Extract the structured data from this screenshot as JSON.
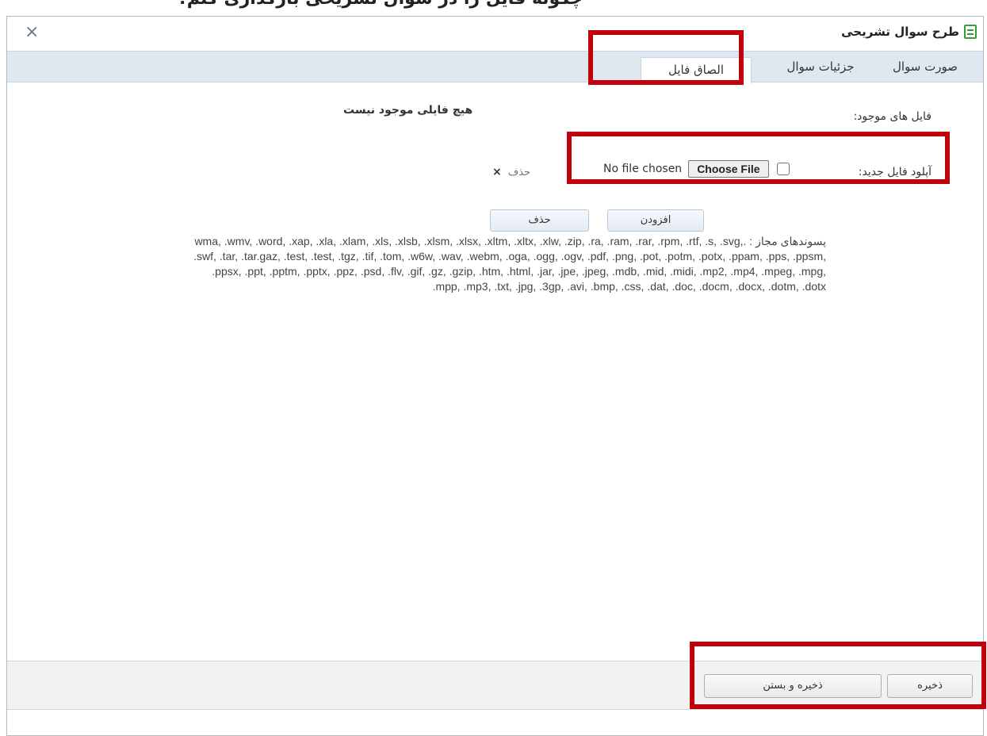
{
  "page_top_caption": "چگونه فایل را در سوال تشریحی بارگذاری کنم؟",
  "dialog": {
    "title": "طرح سوال تشریحی",
    "close_glyph": "×"
  },
  "tabs": [
    {
      "label": "صورت سوال",
      "active": false
    },
    {
      "label": "جزئیات سوال",
      "active": false
    },
    {
      "label": "الصاق فایل",
      "active": true
    }
  ],
  "attach": {
    "existing_label": "فایل های موجود:",
    "no_files_message": "هیچ فایلی موجود نیست",
    "upload_label": "آپلود فایل جدید:",
    "choose_file_label": "Choose File",
    "no_file_chosen": "No file chosen",
    "remove_label": "حذف",
    "remove_glyph": "×",
    "add_button": "افزودن",
    "remove_button": "حذف",
    "allowed_extensions_text": "پسوندهای مجاز : .wma, .wmv, .word, .xap, .xla, .xlam, .xls, .xlsb, .xlsm, .xlsx, .xltm, .xltx, .xlw, .zip, .ra, .ram, .rar, .rpm, .rtf, .s, .svg, .swf, .tar, .tar.gaz, .test, .test, .tgz, .tif, .tom, .w6w, .wav, .webm, .oga, .ogg, .ogv, .pdf, .png, .pot, .potm, .potx, .ppam, .pps, .ppsm, .ppsx, .ppt, .pptm, .pptx, .ppz, .psd, .flv, .gif, .gz, .gzip, .htm, .html, .jar, .jpe, .jpeg, .mdb, .mid, .midi, .mp2, .mp4, .mpeg, .mpg, .mpp, .mp3, .txt, .jpg, .3gp, .avi, .bmp, .css, .dat, .doc, .docm, .docx, .dotm, .dotx"
  },
  "footer": {
    "save_button": "ذخیره",
    "save_close_button": "ذخیره و بستن"
  },
  "colors": {
    "highlight": "#c0000b",
    "tab_bar": "#dfe8f1",
    "title_icon": "#3a9b3a"
  }
}
